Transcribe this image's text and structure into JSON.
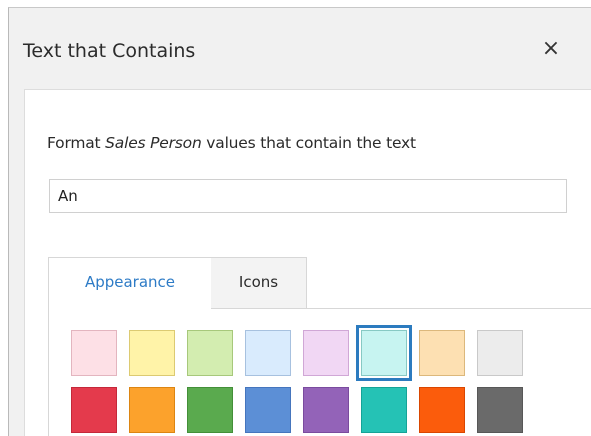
{
  "dialog": {
    "title": "Text that Contains",
    "close_label": "×"
  },
  "form": {
    "instruction_before": "Format ",
    "instruction_field": "Sales Person",
    "instruction_after": " values that contain the text",
    "input_value": "An"
  },
  "tabs": [
    {
      "label": "Appearance",
      "active": true
    },
    {
      "label": "Icons",
      "active": false
    }
  ],
  "swatches": {
    "light": [
      {
        "name": "light-red",
        "fill": "#fde0e6",
        "border": "#e3b5bf"
      },
      {
        "name": "light-yellow",
        "fill": "#fff3a8",
        "border": "#dcca72"
      },
      {
        "name": "light-green",
        "fill": "#d3edb0",
        "border": "#a7c87b"
      },
      {
        "name": "light-blue",
        "fill": "#d9ebfd",
        "border": "#a7c1df"
      },
      {
        "name": "light-purple",
        "fill": "#f1d7f4",
        "border": "#d0a7d6"
      },
      {
        "name": "light-teal",
        "fill": "#c7f4f1",
        "border": "#87c9c4",
        "selected": true
      },
      {
        "name": "light-orange",
        "fill": "#fde0b2",
        "border": "#dcb87c"
      },
      {
        "name": "light-gray",
        "fill": "#ececec",
        "border": "#c9c9c9"
      }
    ],
    "dark": [
      {
        "name": "red",
        "fill": "#e43a4c",
        "border": "#c4283a"
      },
      {
        "name": "orange",
        "fill": "#fca22c",
        "border": "#dc8512"
      },
      {
        "name": "green",
        "fill": "#5aaa4e",
        "border": "#438f38"
      },
      {
        "name": "blue",
        "fill": "#5c8fd6",
        "border": "#4575bd"
      },
      {
        "name": "purple",
        "fill": "#9363b8",
        "border": "#7a4b9e"
      },
      {
        "name": "teal",
        "fill": "#25c2b5",
        "border": "#15a397"
      },
      {
        "name": "dark-orange",
        "fill": "#fb5c0c",
        "border": "#d94600"
      },
      {
        "name": "dark-gray",
        "fill": "#6a6a6a",
        "border": "#575757"
      }
    ]
  }
}
